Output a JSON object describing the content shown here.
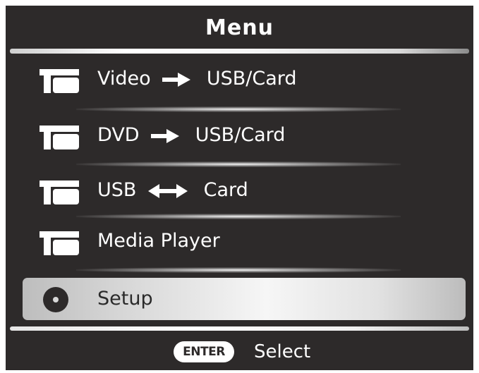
{
  "menu": {
    "title": "Menu",
    "items": [
      {
        "icon": "tv-icon",
        "label_left": "Video",
        "connector": "arrow-right-icon",
        "label_right": "USB/Card"
      },
      {
        "icon": "tv-icon",
        "label_left": "DVD",
        "connector": "arrow-right-icon",
        "label_right": "USB/Card"
      },
      {
        "icon": "tv-icon",
        "label_left": "USB",
        "connector": "arrow-left-right-icon",
        "label_right": "Card"
      },
      {
        "icon": "tv-icon",
        "label": "Media Player"
      },
      {
        "icon": "disc-icon",
        "label": "Setup",
        "selected": true
      }
    ]
  },
  "footer": {
    "button_label": "ENTER",
    "action_label": "Select"
  },
  "colors": {
    "background": "#2d2a2a",
    "text": "#ffffff",
    "selected_text": "#2a2a2a"
  }
}
